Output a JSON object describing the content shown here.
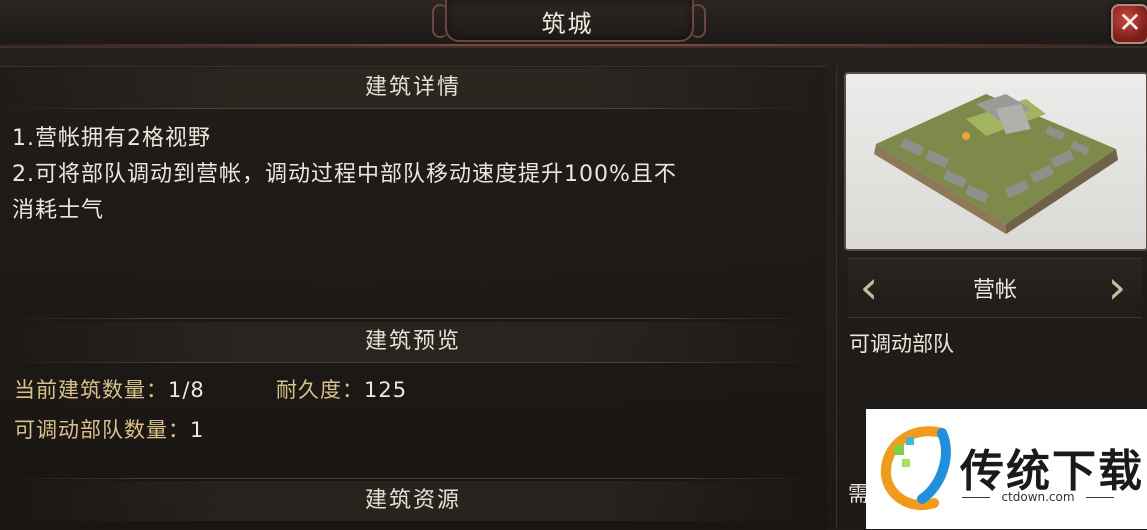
{
  "window": {
    "title": "筑城",
    "close_label": "✕"
  },
  "details": {
    "heading": "建筑详情",
    "lines": [
      "1.营帐拥有2格视野",
      "2.可将部队调动到营帐，调动过程中部队移动速度提升100%且不",
      "消耗士气"
    ]
  },
  "preview_section": {
    "heading": "建筑预览",
    "current_count_label": "当前建筑数量：",
    "current_count_value": "1/8",
    "durability_label": "耐久度：",
    "durability_value": "125",
    "deployable_label": "可调动部队数量：",
    "deployable_value": "1"
  },
  "resources": {
    "heading": "建筑资源"
  },
  "building": {
    "name": "营帐",
    "description": "可调动部队",
    "need_label": "需",
    "prev_icon": "chevron-left-icon",
    "next_icon": "chevron-right-icon"
  },
  "watermark": {
    "brand": "传统下载",
    "url": "ctdown.com"
  },
  "colors": {
    "label_gold": "#d9c08a",
    "text": "#ece6dc",
    "close_red": "#c9473e"
  }
}
